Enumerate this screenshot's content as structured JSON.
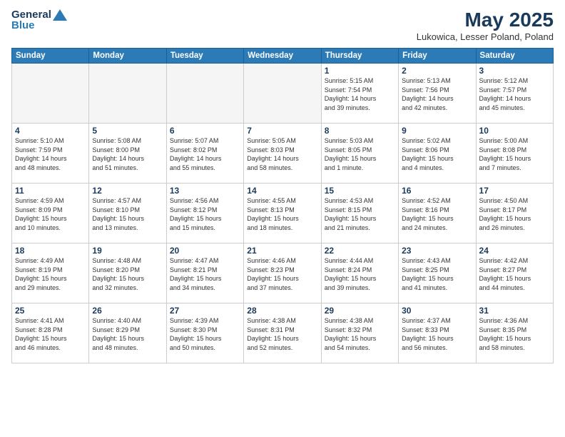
{
  "logo": {
    "line1": "General",
    "line2": "Blue"
  },
  "header": {
    "title": "May 2025",
    "location": "Lukowica, Lesser Poland, Poland"
  },
  "weekdays": [
    "Sunday",
    "Monday",
    "Tuesday",
    "Wednesday",
    "Thursday",
    "Friday",
    "Saturday"
  ],
  "weeks": [
    [
      {
        "day": "",
        "info": ""
      },
      {
        "day": "",
        "info": ""
      },
      {
        "day": "",
        "info": ""
      },
      {
        "day": "",
        "info": ""
      },
      {
        "day": "1",
        "info": "Sunrise: 5:15 AM\nSunset: 7:54 PM\nDaylight: 14 hours\nand 39 minutes."
      },
      {
        "day": "2",
        "info": "Sunrise: 5:13 AM\nSunset: 7:56 PM\nDaylight: 14 hours\nand 42 minutes."
      },
      {
        "day": "3",
        "info": "Sunrise: 5:12 AM\nSunset: 7:57 PM\nDaylight: 14 hours\nand 45 minutes."
      }
    ],
    [
      {
        "day": "4",
        "info": "Sunrise: 5:10 AM\nSunset: 7:59 PM\nDaylight: 14 hours\nand 48 minutes."
      },
      {
        "day": "5",
        "info": "Sunrise: 5:08 AM\nSunset: 8:00 PM\nDaylight: 14 hours\nand 51 minutes."
      },
      {
        "day": "6",
        "info": "Sunrise: 5:07 AM\nSunset: 8:02 PM\nDaylight: 14 hours\nand 55 minutes."
      },
      {
        "day": "7",
        "info": "Sunrise: 5:05 AM\nSunset: 8:03 PM\nDaylight: 14 hours\nand 58 minutes."
      },
      {
        "day": "8",
        "info": "Sunrise: 5:03 AM\nSunset: 8:05 PM\nDaylight: 15 hours\nand 1 minute."
      },
      {
        "day": "9",
        "info": "Sunrise: 5:02 AM\nSunset: 8:06 PM\nDaylight: 15 hours\nand 4 minutes."
      },
      {
        "day": "10",
        "info": "Sunrise: 5:00 AM\nSunset: 8:08 PM\nDaylight: 15 hours\nand 7 minutes."
      }
    ],
    [
      {
        "day": "11",
        "info": "Sunrise: 4:59 AM\nSunset: 8:09 PM\nDaylight: 15 hours\nand 10 minutes."
      },
      {
        "day": "12",
        "info": "Sunrise: 4:57 AM\nSunset: 8:10 PM\nDaylight: 15 hours\nand 13 minutes."
      },
      {
        "day": "13",
        "info": "Sunrise: 4:56 AM\nSunset: 8:12 PM\nDaylight: 15 hours\nand 15 minutes."
      },
      {
        "day": "14",
        "info": "Sunrise: 4:55 AM\nSunset: 8:13 PM\nDaylight: 15 hours\nand 18 minutes."
      },
      {
        "day": "15",
        "info": "Sunrise: 4:53 AM\nSunset: 8:15 PM\nDaylight: 15 hours\nand 21 minutes."
      },
      {
        "day": "16",
        "info": "Sunrise: 4:52 AM\nSunset: 8:16 PM\nDaylight: 15 hours\nand 24 minutes."
      },
      {
        "day": "17",
        "info": "Sunrise: 4:50 AM\nSunset: 8:17 PM\nDaylight: 15 hours\nand 26 minutes."
      }
    ],
    [
      {
        "day": "18",
        "info": "Sunrise: 4:49 AM\nSunset: 8:19 PM\nDaylight: 15 hours\nand 29 minutes."
      },
      {
        "day": "19",
        "info": "Sunrise: 4:48 AM\nSunset: 8:20 PM\nDaylight: 15 hours\nand 32 minutes."
      },
      {
        "day": "20",
        "info": "Sunrise: 4:47 AM\nSunset: 8:21 PM\nDaylight: 15 hours\nand 34 minutes."
      },
      {
        "day": "21",
        "info": "Sunrise: 4:46 AM\nSunset: 8:23 PM\nDaylight: 15 hours\nand 37 minutes."
      },
      {
        "day": "22",
        "info": "Sunrise: 4:44 AM\nSunset: 8:24 PM\nDaylight: 15 hours\nand 39 minutes."
      },
      {
        "day": "23",
        "info": "Sunrise: 4:43 AM\nSunset: 8:25 PM\nDaylight: 15 hours\nand 41 minutes."
      },
      {
        "day": "24",
        "info": "Sunrise: 4:42 AM\nSunset: 8:27 PM\nDaylight: 15 hours\nand 44 minutes."
      }
    ],
    [
      {
        "day": "25",
        "info": "Sunrise: 4:41 AM\nSunset: 8:28 PM\nDaylight: 15 hours\nand 46 minutes."
      },
      {
        "day": "26",
        "info": "Sunrise: 4:40 AM\nSunset: 8:29 PM\nDaylight: 15 hours\nand 48 minutes."
      },
      {
        "day": "27",
        "info": "Sunrise: 4:39 AM\nSunset: 8:30 PM\nDaylight: 15 hours\nand 50 minutes."
      },
      {
        "day": "28",
        "info": "Sunrise: 4:38 AM\nSunset: 8:31 PM\nDaylight: 15 hours\nand 52 minutes."
      },
      {
        "day": "29",
        "info": "Sunrise: 4:38 AM\nSunset: 8:32 PM\nDaylight: 15 hours\nand 54 minutes."
      },
      {
        "day": "30",
        "info": "Sunrise: 4:37 AM\nSunset: 8:33 PM\nDaylight: 15 hours\nand 56 minutes."
      },
      {
        "day": "31",
        "info": "Sunrise: 4:36 AM\nSunset: 8:35 PM\nDaylight: 15 hours\nand 58 minutes."
      }
    ]
  ]
}
